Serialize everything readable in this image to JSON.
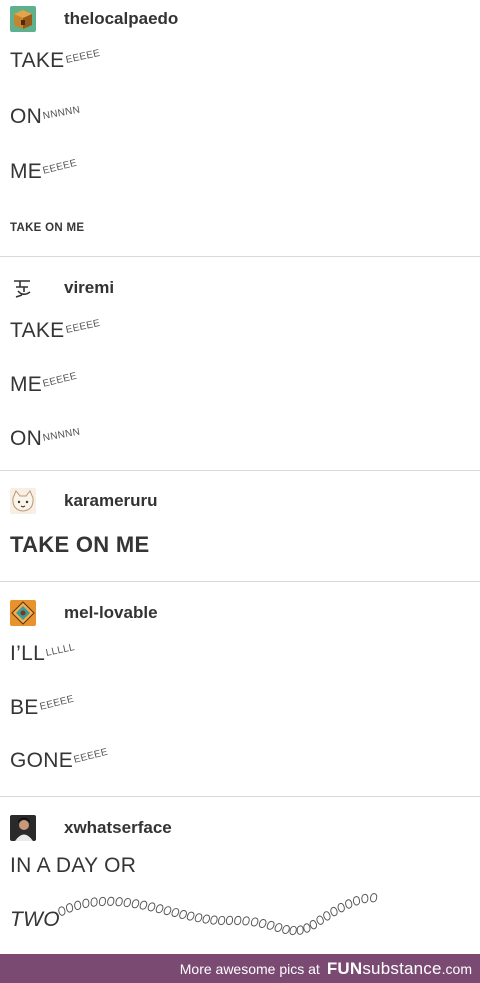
{
  "posts": [
    {
      "username": "thelocalpaedo",
      "avatar_icon": "box-avatar-icon",
      "lines": [
        "TAKE",
        "ON",
        "ME",
        "TAKE ON ME"
      ],
      "trails": [
        "EEEEE",
        "NNNNN",
        "EEEEE"
      ]
    },
    {
      "username": "viremi",
      "avatar_icon": "sketch-avatar-icon",
      "lines": [
        "TAKE",
        "ME",
        "ON"
      ],
      "trails": [
        "EEEEE",
        "EEEEE",
        "NNNNN"
      ]
    },
    {
      "username": "karameruru",
      "avatar_icon": "cat-avatar-icon",
      "lines": [
        "TAKE ON ME"
      ]
    },
    {
      "username": "mel-lovable",
      "avatar_icon": "diamond-avatar-icon",
      "lines": [
        "I’LL",
        "BE",
        "GONE"
      ],
      "trails": [
        "LLLLL",
        "EEEEE",
        "EEEEE"
      ]
    },
    {
      "username": "xwhatserface",
      "avatar_icon": "photo-avatar-icon",
      "lines": [
        "IN A DAY OR",
        "TWO"
      ],
      "trails": [
        "OOOOOOOOOOOOOOOOOOOOOOOOOOOOOOOOOOOOOOOOO"
      ]
    }
  ],
  "footer": {
    "text": "More awesome pics at",
    "brand_bold": "FUN",
    "brand_light": "substance",
    "domain": ".com"
  },
  "colors": {
    "footer_bg": "#7a4a73",
    "divider": "#d9d9d9"
  }
}
